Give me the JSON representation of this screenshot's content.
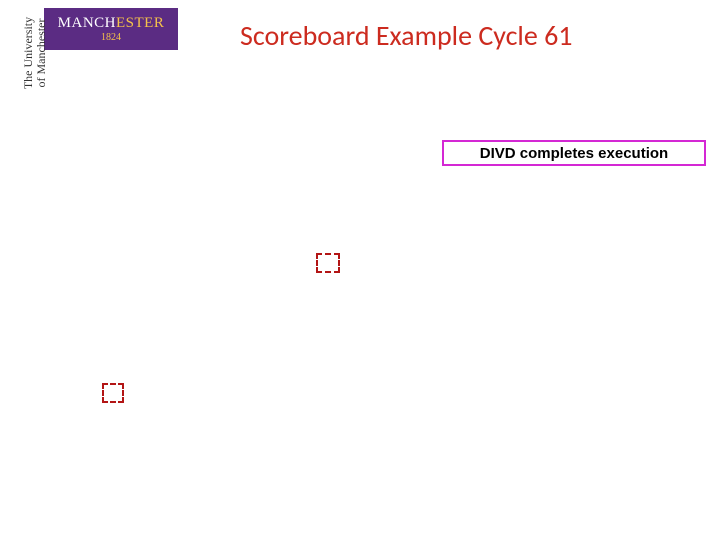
{
  "logo": {
    "wordmark_left": "MANCH",
    "wordmark_right": "ESTER",
    "year": "1824"
  },
  "sidetext": {
    "line1": "The University",
    "line2": "of Manchester"
  },
  "title": "Scoreboard Example Cycle 61",
  "callout": "DIVD completes execution"
}
